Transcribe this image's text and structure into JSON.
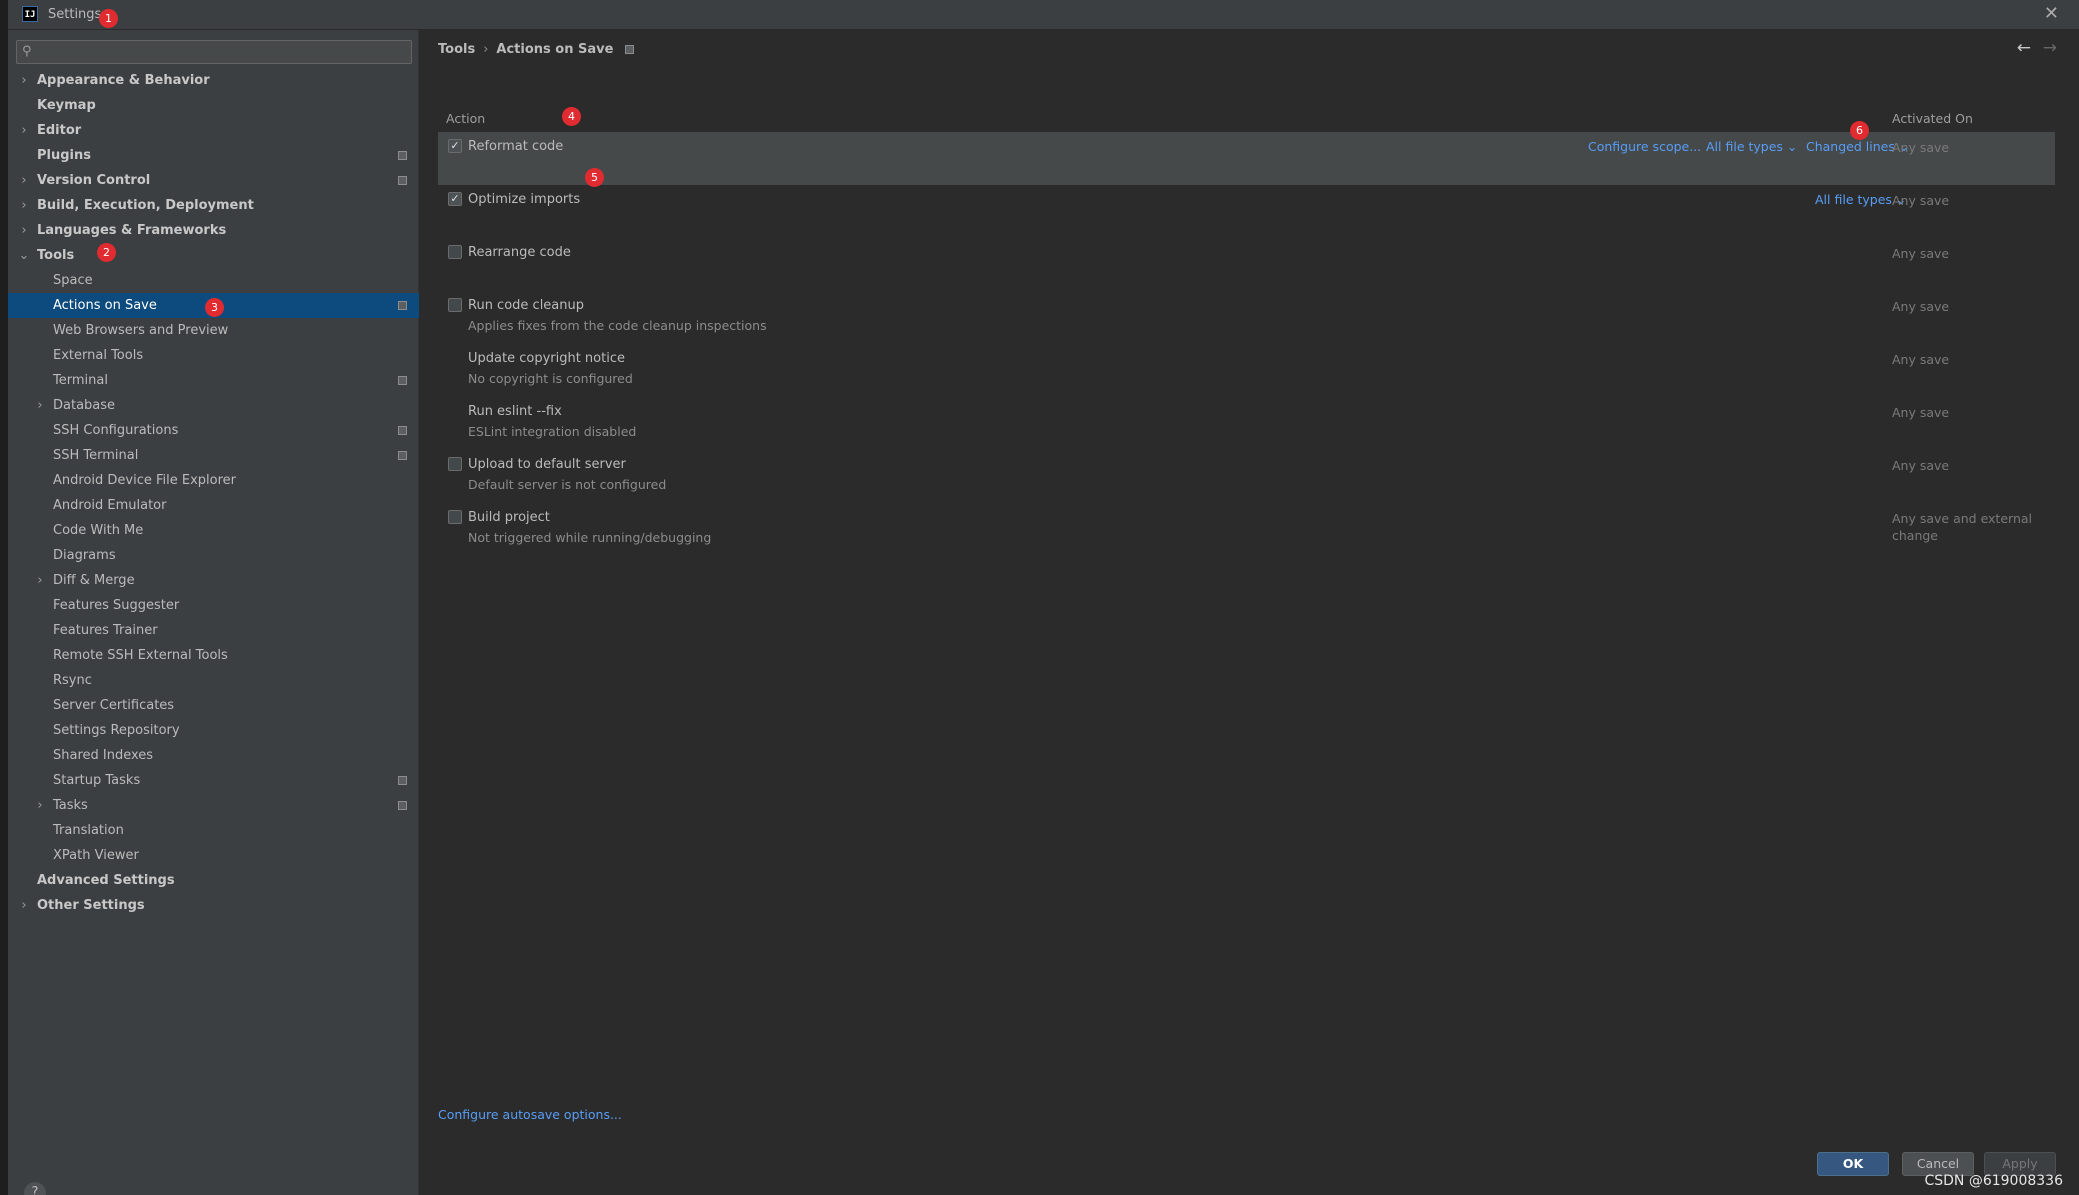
{
  "window": {
    "title": "Settings",
    "logo_text": "IJ",
    "close_glyph": "✕",
    "badges": [
      "1",
      "2",
      "3",
      "4",
      "5",
      "6"
    ]
  },
  "sidebar": {
    "search_icon": "⚲",
    "items": [
      {
        "label": "Appearance & Behavior",
        "level": 0,
        "expandable": true,
        "expanded": false,
        "bold": true,
        "project_icon": false
      },
      {
        "label": "Keymap",
        "level": 0,
        "expandable": false,
        "bold": true,
        "project_icon": false
      },
      {
        "label": "Editor",
        "level": 0,
        "expandable": true,
        "expanded": false,
        "bold": true,
        "project_icon": false
      },
      {
        "label": "Plugins",
        "level": 0,
        "expandable": false,
        "bold": true,
        "project_icon": true
      },
      {
        "label": "Version Control",
        "level": 0,
        "expandable": true,
        "expanded": false,
        "bold": true,
        "project_icon": true
      },
      {
        "label": "Build, Execution, Deployment",
        "level": 0,
        "expandable": true,
        "expanded": false,
        "bold": true,
        "project_icon": false
      },
      {
        "label": "Languages & Frameworks",
        "level": 0,
        "expandable": true,
        "expanded": false,
        "bold": true,
        "project_icon": false
      },
      {
        "label": "Tools",
        "level": 0,
        "expandable": true,
        "expanded": true,
        "bold": true,
        "project_icon": false
      },
      {
        "label": "Space",
        "level": 1,
        "expandable": false,
        "project_icon": false
      },
      {
        "label": "Actions on Save",
        "level": 1,
        "expandable": false,
        "selected": true,
        "project_icon": true
      },
      {
        "label": "Web Browsers and Preview",
        "level": 1,
        "expandable": false,
        "project_icon": false
      },
      {
        "label": "External Tools",
        "level": 1,
        "expandable": false,
        "project_icon": false
      },
      {
        "label": "Terminal",
        "level": 1,
        "expandable": false,
        "project_icon": true
      },
      {
        "label": "Database",
        "level": 1,
        "expandable": true,
        "expanded": false,
        "project_icon": false
      },
      {
        "label": "SSH Configurations",
        "level": 1,
        "expandable": false,
        "project_icon": true
      },
      {
        "label": "SSH Terminal",
        "level": 1,
        "expandable": false,
        "project_icon": true
      },
      {
        "label": "Android Device File Explorer",
        "level": 1,
        "expandable": false,
        "project_icon": false
      },
      {
        "label": "Android Emulator",
        "level": 1,
        "expandable": false,
        "project_icon": false
      },
      {
        "label": "Code With Me",
        "level": 1,
        "expandable": false,
        "project_icon": false
      },
      {
        "label": "Diagrams",
        "level": 1,
        "expandable": false,
        "project_icon": false
      },
      {
        "label": "Diff & Merge",
        "level": 1,
        "expandable": true,
        "expanded": false,
        "project_icon": false
      },
      {
        "label": "Features Suggester",
        "level": 1,
        "expandable": false,
        "project_icon": false
      },
      {
        "label": "Features Trainer",
        "level": 1,
        "expandable": false,
        "project_icon": false
      },
      {
        "label": "Remote SSH External Tools",
        "level": 1,
        "expandable": false,
        "project_icon": false
      },
      {
        "label": "Rsync",
        "level": 1,
        "expandable": false,
        "project_icon": false
      },
      {
        "label": "Server Certificates",
        "level": 1,
        "expandable": false,
        "project_icon": false
      },
      {
        "label": "Settings Repository",
        "level": 1,
        "expandable": false,
        "project_icon": false
      },
      {
        "label": "Shared Indexes",
        "level": 1,
        "expandable": false,
        "project_icon": false
      },
      {
        "label": "Startup Tasks",
        "level": 1,
        "expandable": false,
        "project_icon": true
      },
      {
        "label": "Tasks",
        "level": 1,
        "expandable": true,
        "expanded": false,
        "project_icon": true
      },
      {
        "label": "Translation",
        "level": 1,
        "expandable": false,
        "project_icon": false
      },
      {
        "label": "XPath Viewer",
        "level": 1,
        "expandable": false,
        "project_icon": false
      },
      {
        "label": "Advanced Settings",
        "level": 0,
        "expandable": false,
        "bold": true,
        "project_icon": false
      },
      {
        "label": "Other Settings",
        "level": 0,
        "expandable": true,
        "expanded": false,
        "bold": true,
        "project_icon": false
      }
    ],
    "help_label": "?"
  },
  "main": {
    "breadcrumb": {
      "parent": "Tools",
      "separator": "›",
      "current": "Actions on Save"
    },
    "nav_back": "←",
    "nav_forward": "→",
    "columns": {
      "action": "Action",
      "activated_on": "Activated On"
    },
    "rows": [
      {
        "title": "Reformat code",
        "subtitle": "",
        "checkbox": true,
        "checked": true,
        "highlight": true,
        "links": [
          "Configure scope...",
          "All file types ⌄",
          "Changed lines ⌄"
        ],
        "activated": "Any save"
      },
      {
        "title": "Optimize imports",
        "subtitle": "",
        "checkbox": true,
        "checked": true,
        "highlight": false,
        "links": [
          "All file types ⌄"
        ],
        "activated": "Any save"
      },
      {
        "title": "Rearrange code",
        "subtitle": "",
        "checkbox": true,
        "checked": false,
        "highlight": false,
        "links": [],
        "activated": "Any save"
      },
      {
        "title": "Run code cleanup",
        "subtitle": "Applies fixes from the code cleanup inspections",
        "checkbox": true,
        "checked": false,
        "highlight": false,
        "links": [],
        "activated": "Any save"
      },
      {
        "title": "Update copyright notice",
        "subtitle": "No copyright is configured",
        "checkbox": false,
        "checked": false,
        "highlight": false,
        "links": [],
        "activated": "Any save"
      },
      {
        "title": "Run eslint --fix",
        "subtitle": "ESLint integration disabled",
        "checkbox": false,
        "checked": false,
        "highlight": false,
        "links": [],
        "activated": "Any save"
      },
      {
        "title": "Upload to default server",
        "subtitle": "Default server is not configured",
        "checkbox": true,
        "checked": false,
        "highlight": false,
        "links": [],
        "activated": "Any save"
      },
      {
        "title": "Build project",
        "subtitle": "Not triggered while running/debugging",
        "checkbox": true,
        "checked": false,
        "highlight": false,
        "links": [],
        "activated": "Any save and external change"
      }
    ],
    "autosave_link": "Configure autosave options...",
    "buttons": {
      "ok": "OK",
      "cancel": "Cancel",
      "apply": "Apply"
    }
  },
  "watermark": "CSDN @619008336"
}
